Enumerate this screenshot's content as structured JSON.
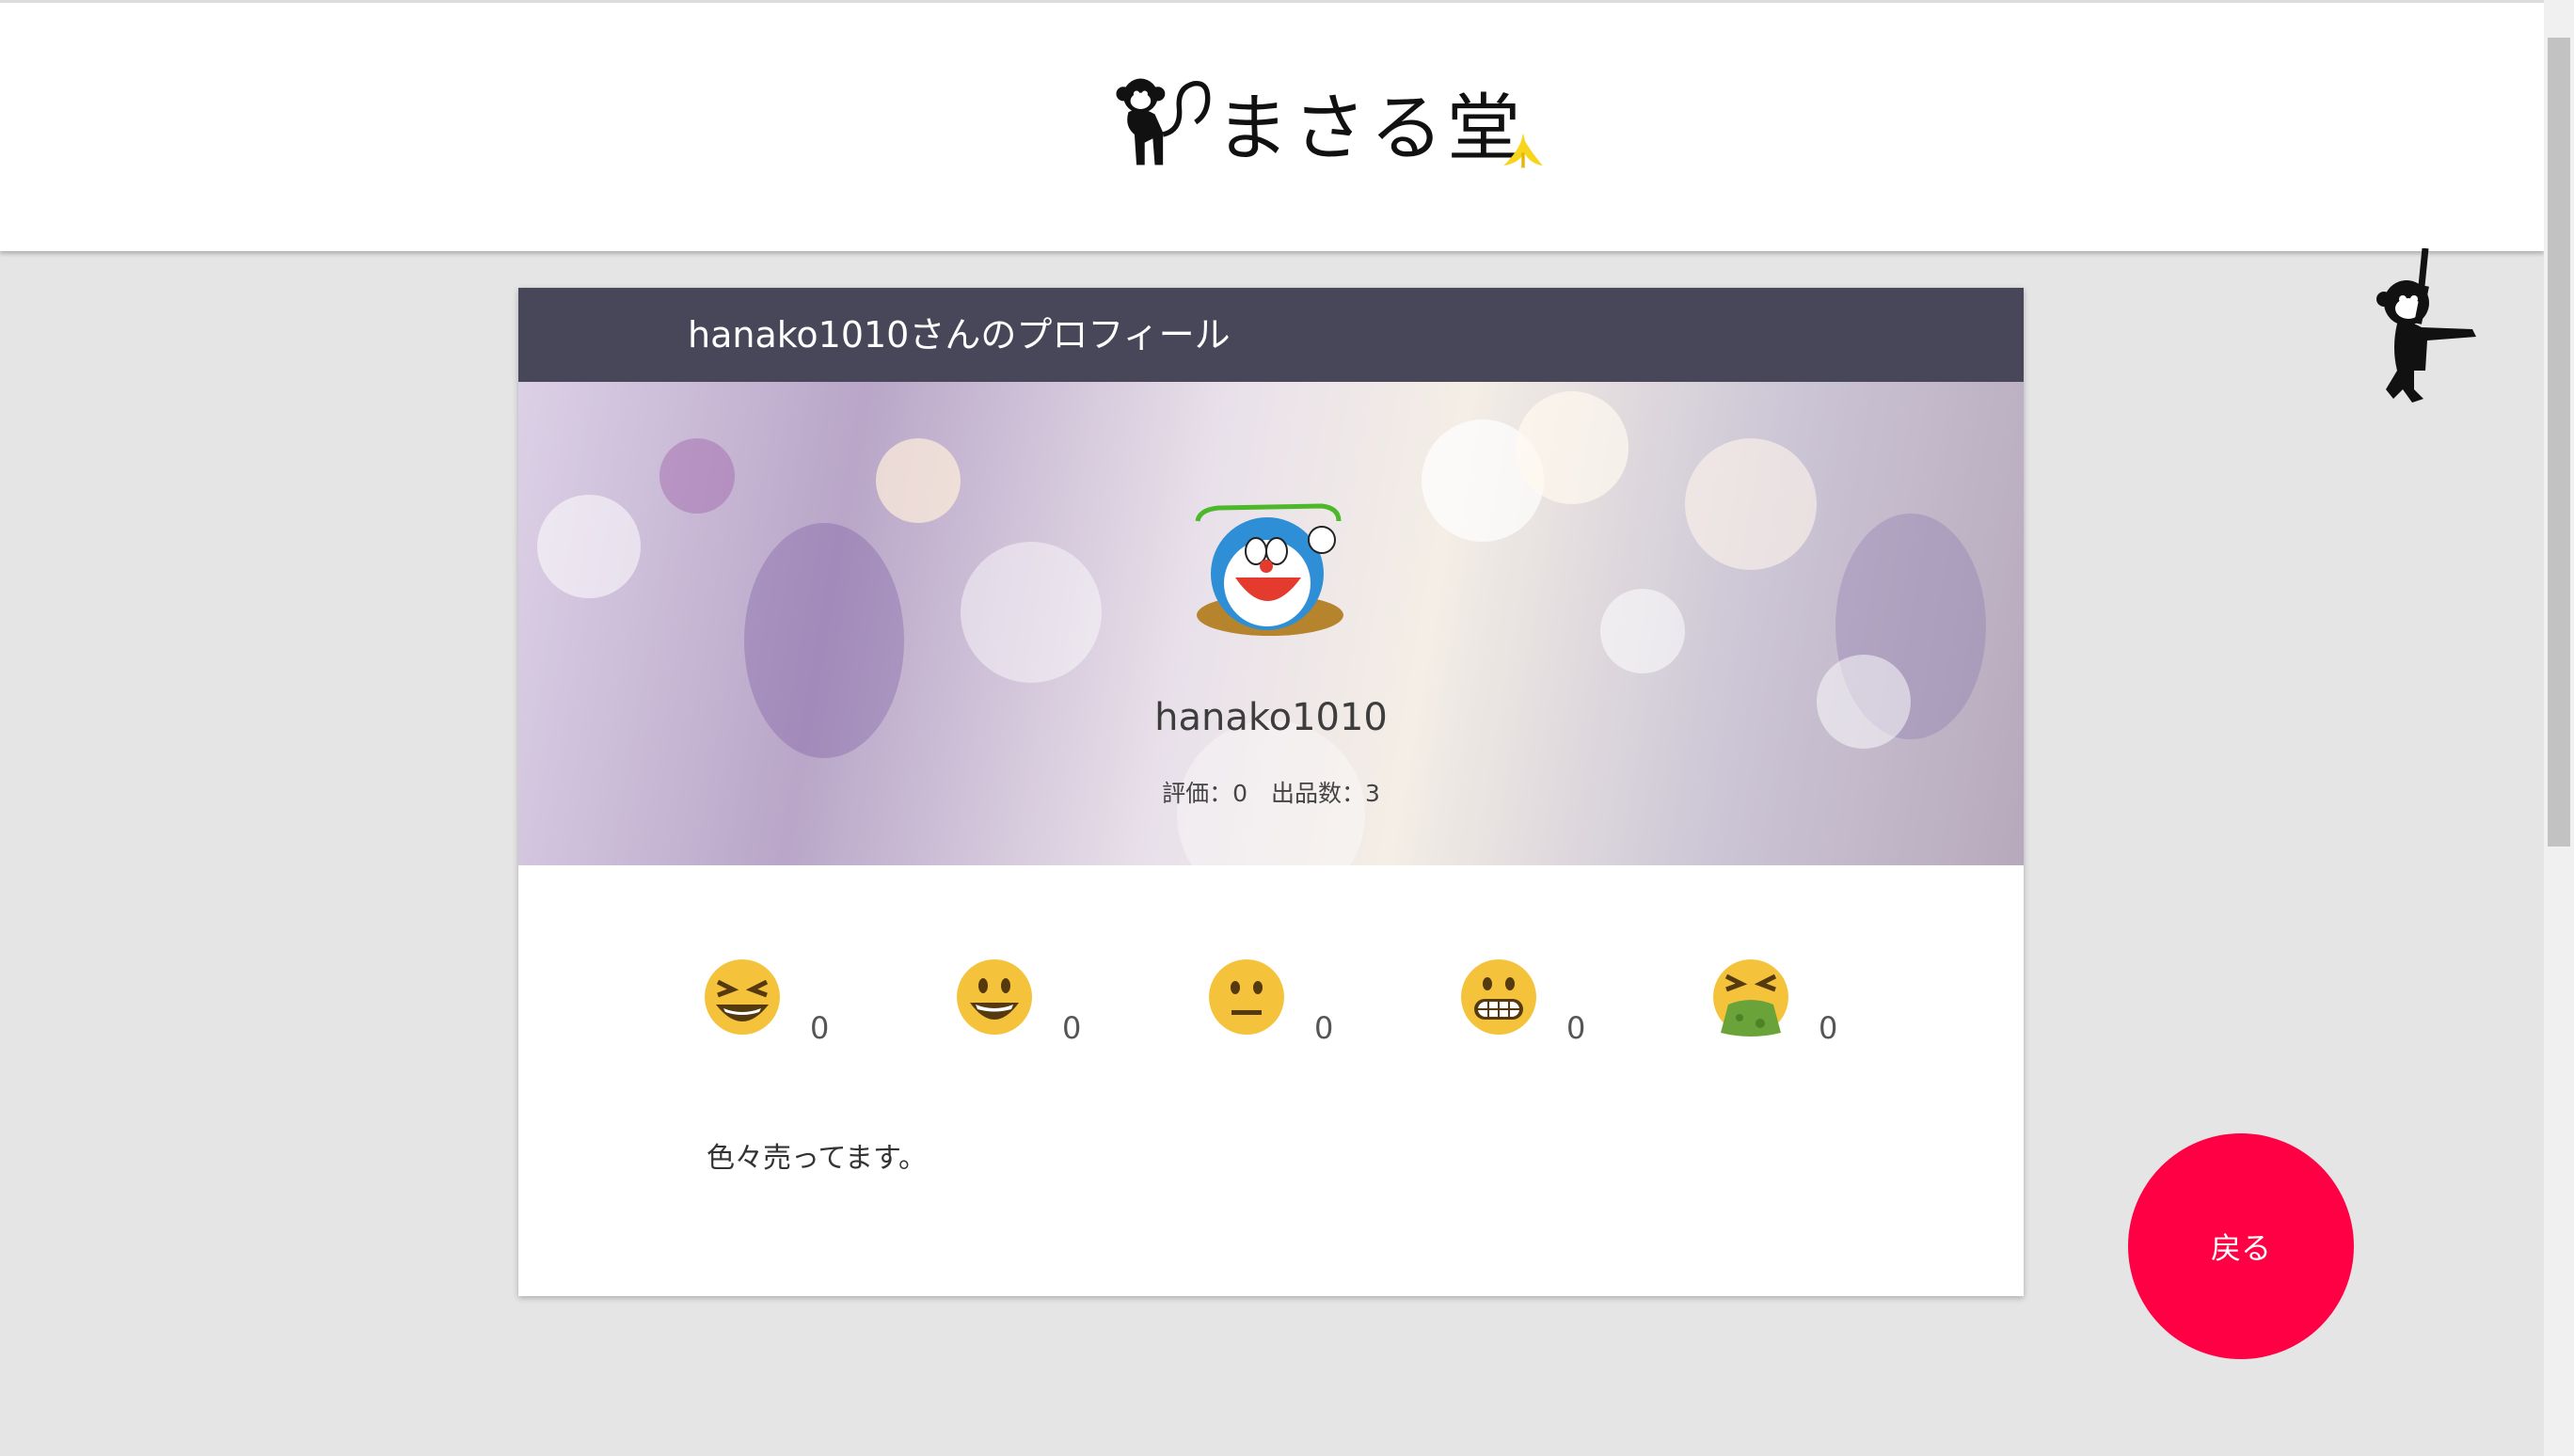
{
  "header": {
    "brand_name": "まさる堂"
  },
  "profile": {
    "title": "hanako1010さんのプロフィール",
    "username": "hanako1010",
    "stats": "評価：0　出品数：3",
    "bio": "色々売ってます。"
  },
  "ratings": [
    {
      "icon": "laughing-face-icon",
      "count": "0"
    },
    {
      "icon": "smiling-face-icon",
      "count": "0"
    },
    {
      "icon": "neutral-face-icon",
      "count": "0"
    },
    {
      "icon": "grimacing-face-icon",
      "count": "0"
    },
    {
      "icon": "vomiting-face-icon",
      "count": "0"
    }
  ],
  "back_button": {
    "label": "戻る"
  },
  "colors": {
    "header_bar": "#484759",
    "back_button": "#ff0044",
    "background": "#e5e5e5"
  }
}
